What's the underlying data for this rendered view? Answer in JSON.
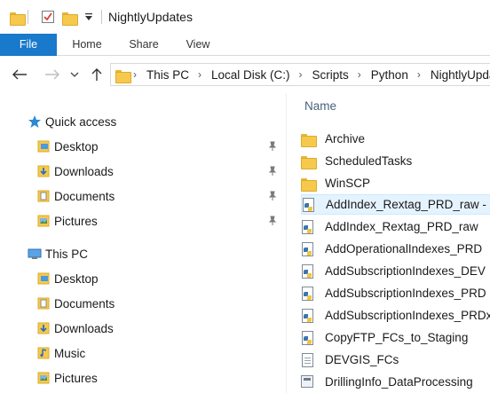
{
  "window": {
    "title": "NightlyUpdates"
  },
  "ribbon": {
    "tabs": [
      "File",
      "Home",
      "Share",
      "View"
    ]
  },
  "address": {
    "crumbs": [
      "This PC",
      "Local Disk (C:)",
      "Scripts",
      "Python",
      "NightlyUpdates"
    ]
  },
  "nav": {
    "quick_access": "Quick access",
    "quick_items": [
      "Desktop",
      "Downloads",
      "Documents",
      "Pictures"
    ],
    "this_pc": "This PC",
    "pc_items": [
      "Desktop",
      "Documents",
      "Downloads",
      "Music",
      "Pictures"
    ]
  },
  "content": {
    "column_header": "Name",
    "sort_caret": "^",
    "files": [
      {
        "name": "Archive",
        "type": "folder"
      },
      {
        "name": "ScheduledTasks",
        "type": "folder"
      },
      {
        "name": "WinSCP",
        "type": "folder"
      },
      {
        "name": "AddIndex_Rextag_PRD_raw - Copy",
        "type": "python",
        "selected": true
      },
      {
        "name": "AddIndex_Rextag_PRD_raw",
        "type": "python"
      },
      {
        "name": "AddOperationalIndexes_PRD",
        "type": "python"
      },
      {
        "name": "AddSubscriptionIndexes_DEV",
        "type": "python"
      },
      {
        "name": "AddSubscriptionIndexes_PRD",
        "type": "python"
      },
      {
        "name": "AddSubscriptionIndexes_PRDx",
        "type": "python"
      },
      {
        "name": "CopyFTP_FCs_to_Staging",
        "type": "python"
      },
      {
        "name": "DEVGIS_FCs",
        "type": "text"
      },
      {
        "name": "DrillingInfo_DataProcessing",
        "type": "process"
      }
    ]
  },
  "colors": {
    "accent": "#1979ca",
    "folder": "#f6c94c",
    "selection": "#e5f3ff"
  }
}
